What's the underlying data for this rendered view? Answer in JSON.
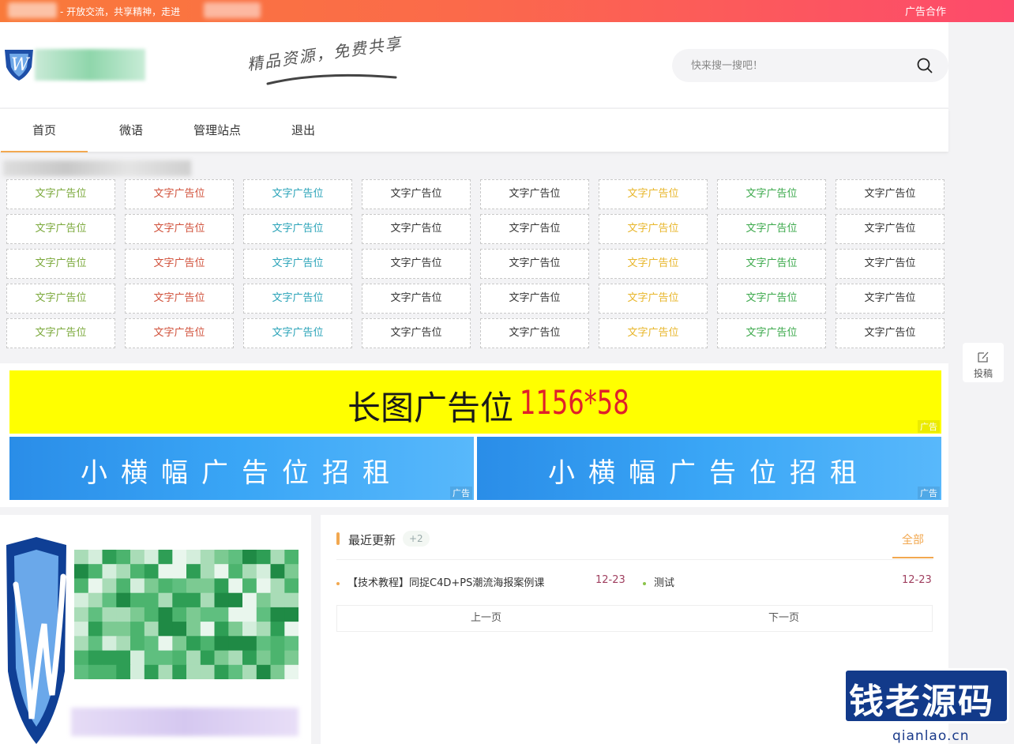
{
  "topbar": {
    "slogan": "- 开放交流，共享精神，走进",
    "ad_link": "广告合作"
  },
  "header": {
    "tagline": "精品资源，免费共享",
    "search_placeholder": "快来搜一搜吧！"
  },
  "nav": {
    "items": [
      "首页",
      "微语",
      "管理站点",
      "退出"
    ],
    "active_index": 0
  },
  "text_ads": {
    "label": "文字广告位",
    "column_colors": [
      "#7aa83a",
      "#d0503a",
      "#2aa3b8",
      "#333333",
      "#333333",
      "#e8b62a",
      "#3aa84a",
      "#333333"
    ]
  },
  "banners": {
    "long": {
      "label": "长图广告位",
      "size": "1156*58",
      "tag": "广告"
    },
    "small": [
      {
        "label": "小横幅广告位招租",
        "tag": "广告"
      },
      {
        "label": "小横幅广告位招租",
        "tag": "广告"
      }
    ]
  },
  "updates": {
    "title": "最近更新",
    "count": "+2",
    "all_link": "全部",
    "posts": [
      {
        "title": "【技术教程】同捉C4D+PS潮流海报案例课",
        "date": "12-23",
        "dot_color": "#f2a850"
      },
      {
        "title": "测试",
        "date": "12-23",
        "dot_color": "#8bc34a"
      }
    ],
    "prev": "上一页",
    "next": "下一页"
  },
  "float": {
    "submit": "投稿"
  },
  "watermark": {
    "brand": "钱老源码",
    "url": "qianlao.cn"
  }
}
